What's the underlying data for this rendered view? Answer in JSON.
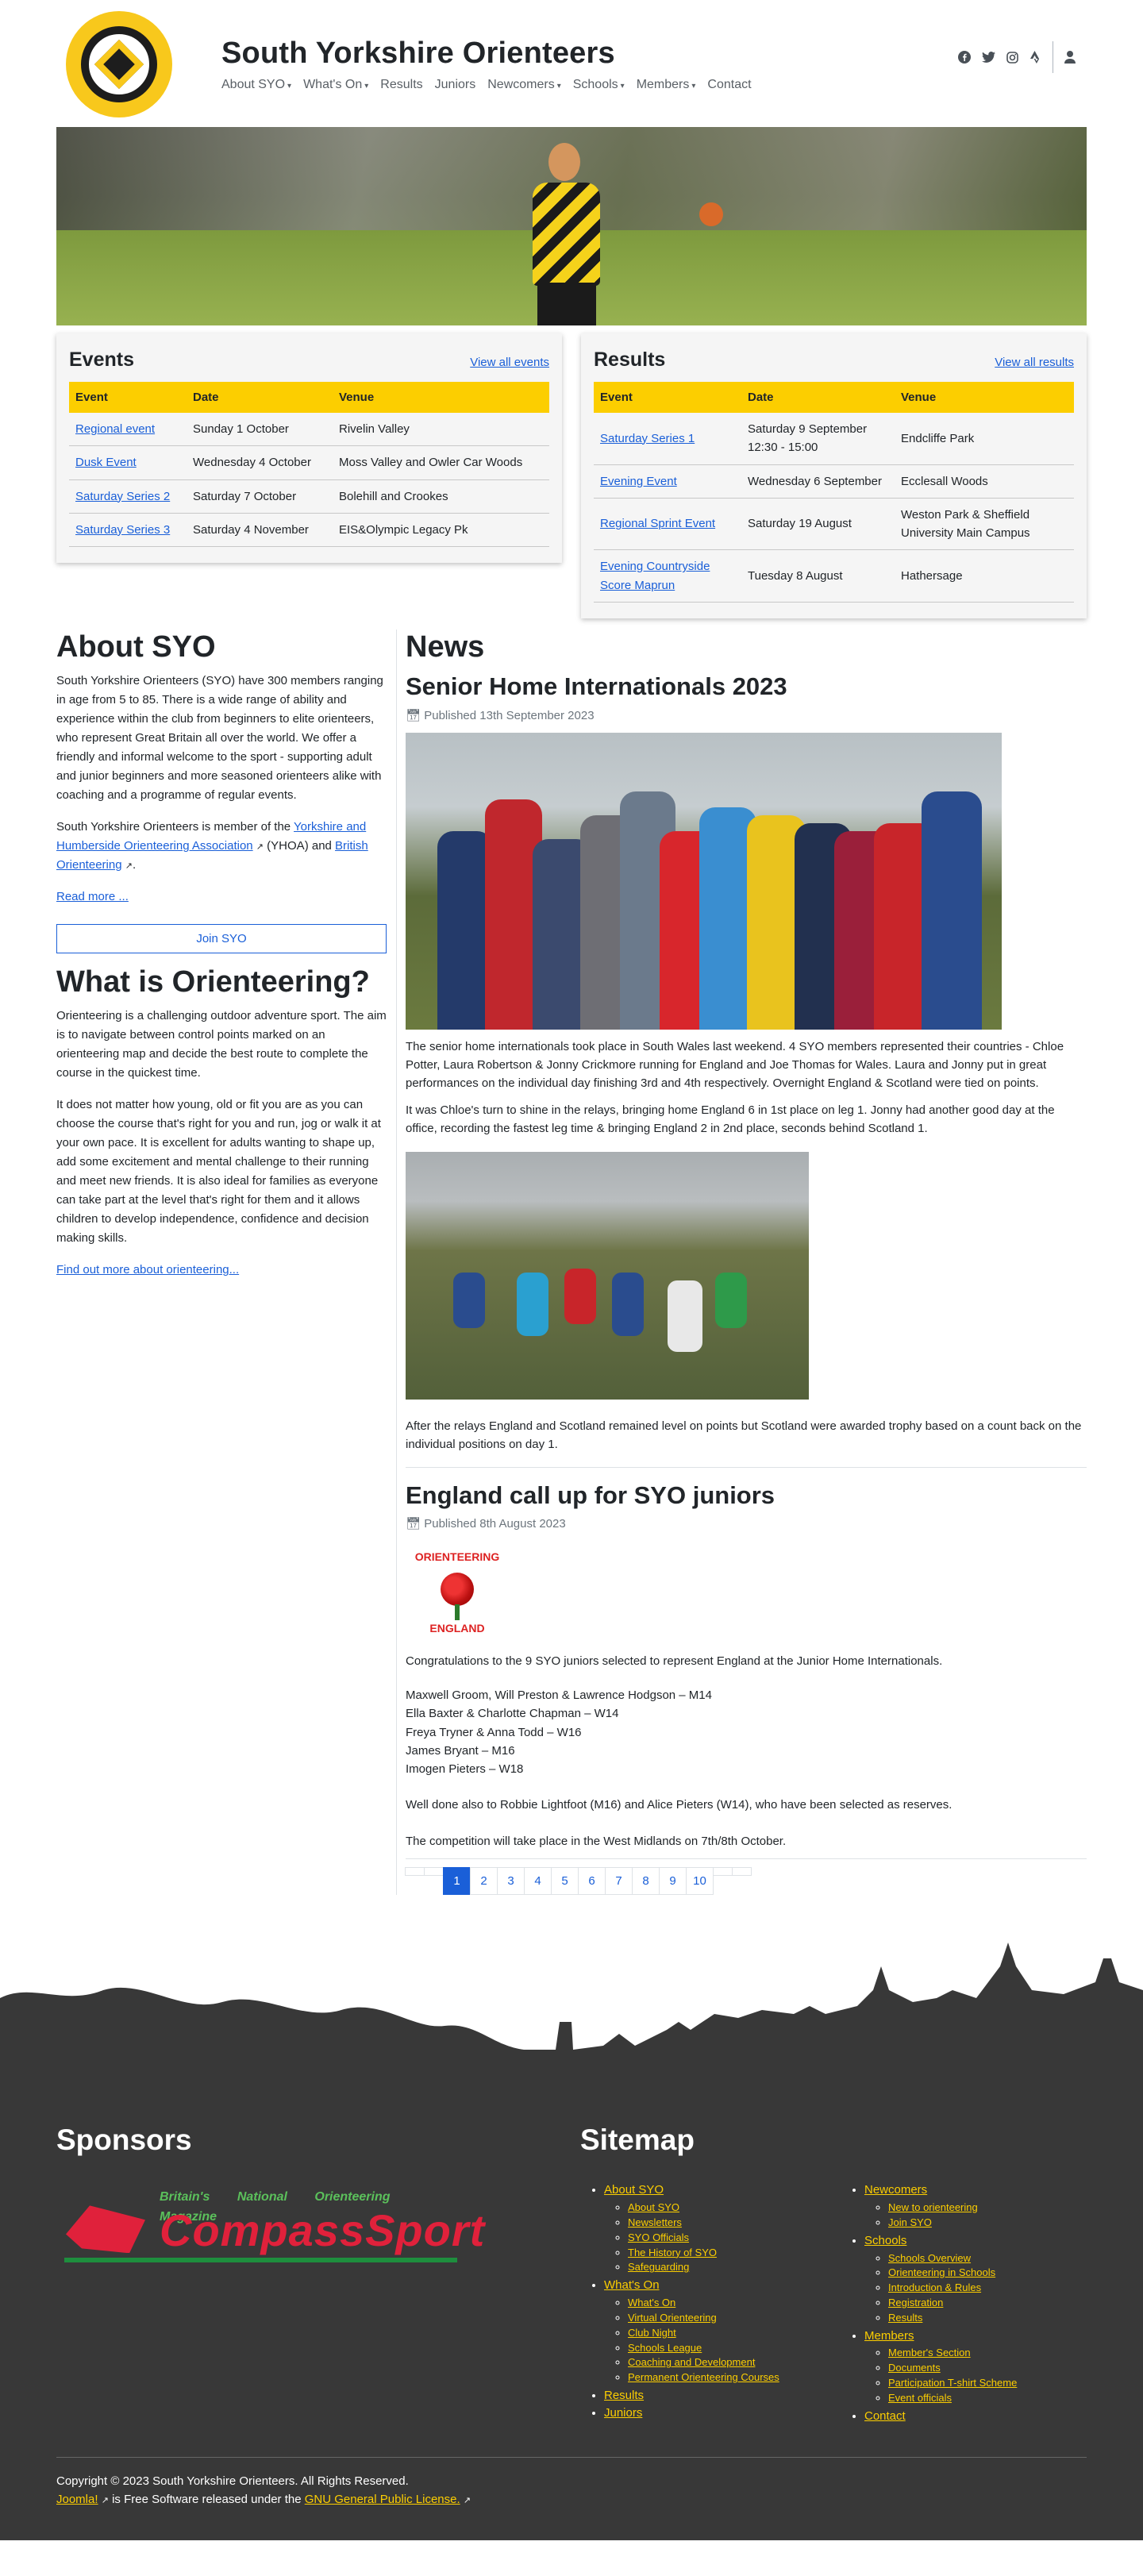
{
  "site": {
    "title": "South Yorkshire Orienteers"
  },
  "nav": [
    {
      "label": "About SYO",
      "dropdown": true
    },
    {
      "label": "What's On",
      "dropdown": true
    },
    {
      "label": "Results",
      "dropdown": false
    },
    {
      "label": "Juniors",
      "dropdown": false
    },
    {
      "label": "Newcomers",
      "dropdown": true
    },
    {
      "label": "Schools",
      "dropdown": true
    },
    {
      "label": "Members",
      "dropdown": true
    },
    {
      "label": "Contact",
      "dropdown": false
    }
  ],
  "social_icons": [
    "facebook-icon",
    "twitter-icon",
    "instagram-icon",
    "strava-icon",
    "user-icon"
  ],
  "events": {
    "title": "Events",
    "link": "View all events",
    "headers": [
      "Event",
      "Date",
      "Venue"
    ],
    "rows": [
      {
        "event": "Regional event",
        "date": "Sunday 1 October",
        "venue": "Rivelin Valley"
      },
      {
        "event": "Dusk Event",
        "date": "Wednesday 4 October",
        "venue": "Moss Valley and Owler Car Woods"
      },
      {
        "event": "Saturday Series 2",
        "date": "Saturday 7 October",
        "venue": "Bolehill and Crookes"
      },
      {
        "event": "Saturday Series 3",
        "date": "Saturday 4 November",
        "venue": "EIS&Olympic Legacy Pk"
      }
    ]
  },
  "results": {
    "title": "Results",
    "link": "View all results",
    "headers": [
      "Event",
      "Date",
      "Venue"
    ],
    "rows": [
      {
        "event": "Saturday Series 1",
        "date": "Saturday 9 September 12:30 - 15:00",
        "venue": "Endcliffe Park"
      },
      {
        "event": "Evening Event",
        "date": "Wednesday 6 September",
        "venue": "Ecclesall Woods"
      },
      {
        "event": "Regional Sprint Event",
        "date": "Saturday 19 August",
        "venue": "Weston Park & Sheffield University Main Campus"
      },
      {
        "event": "Evening Countryside Score Maprun",
        "date": "Tuesday 8 August",
        "venue": "Hathersage"
      }
    ]
  },
  "about": {
    "title": "About SYO",
    "p1": "South Yorkshire Orienteers (SYO) have 300 members ranging in age from 5 to 85. There is a wide range of ability and experience within the club from beginners to elite orienteers, who represent Great Britain all over the world. We offer a friendly and informal welcome to the sport - supporting adult and junior beginners and more seasoned orienteers alike with coaching and a programme of regular events.",
    "p2_prefix": "South Yorkshire Orienteers is member of the ",
    "p2_link1": "Yorkshire and Humberside Orienteering Association",
    "p2_mid": " (YHOA) and ",
    "p2_link2": "British Orienteering",
    "p2_suffix": ".",
    "read_more": "Read more ...",
    "join": "Join SYO"
  },
  "what_is": {
    "title": "What is Orienteering?",
    "p1": "Orienteering is a challenging outdoor adventure sport. The aim is to navigate between control points marked on an orienteering map and decide the best route to complete the course in the quickest time.",
    "p2": "It does not matter how young, old or fit you are as you can choose the course that's right for you and run, jog or walk it at your own pace. It is excellent for adults wanting to shape up, add some excitement and mental challenge to their running and meet new friends. It is also ideal for families as everyone can take part at the level that's right for them and it allows children to develop independence, confidence and decision making skills.",
    "link": "Find out more about orienteering..."
  },
  "news": {
    "title": "News",
    "article1": {
      "title": "Senior Home Internationals 2023",
      "published": "Published 13th September 2023",
      "p1": "The senior home internationals took place in South Wales last weekend. 4 SYO members represented their countries - Chloe Potter, Laura Robertson & Jonny Crickmore running for England and Joe Thomas for Wales. Laura and Jonny put in great performances on the individual day finishing 3rd and 4th respectively. Overnight England & Scotland were tied on points.",
      "p2": "It was Chloe's turn to shine in the relays, bringing home England 6 in 1st place on leg 1. Jonny had another good day at the office, recording the fastest leg time & bringing England 2 in 2nd place, seconds behind Scotland 1.",
      "p3": "After the relays England and Scotland remained level on points but Scotland were awarded trophy based on a count back on the individual positions on day 1."
    },
    "article2": {
      "title": "England call up for SYO juniors",
      "published": "Published 8th August 2023",
      "badge_top": "ORIENTEERING",
      "badge_bottom": "ENGLAND",
      "intro": "Congratulations to the 9 SYO juniors selected to represent England at the Junior Home Internationals.",
      "selections": [
        "Maxwell Groom, Will Preston & Lawrence Hodgson – M14",
        "Ella Baxter & Charlotte Chapman – W14",
        "Freya Tryner & Anna Todd – W16",
        "James Bryant – M16",
        "Imogen Pieters – W18"
      ],
      "reserves": "Well done also to Robbie Lightfoot (M16) and Alice Pieters (W14), who have been selected as reserves.",
      "closing": "The competition will take place in the West Midlands on 7th/8th October."
    },
    "pages": [
      "1",
      "2",
      "3",
      "4",
      "5",
      "6",
      "7",
      "8",
      "9",
      "10"
    ],
    "active_page": "1"
  },
  "footer": {
    "sponsors_title": "Sponsors",
    "sponsor_tag": "Britain's National Orienteering Magazine",
    "sponsor_name": "CompassSport",
    "sitemap_title": "Sitemap",
    "sitemap_col1": [
      {
        "label": "About SYO",
        "children": [
          "About SYO",
          "Newsletters",
          "SYO Officials",
          "The History of SYO",
          "Safeguarding"
        ]
      },
      {
        "label": "What's On",
        "children": [
          "What's On",
          "Virtual Orienteering",
          "Club Night",
          "Schools League",
          "Coaching and Development",
          "Permanent Orienteering Courses"
        ]
      },
      {
        "label": "Results",
        "children": []
      },
      {
        "label": "Juniors",
        "children": []
      }
    ],
    "sitemap_col2": [
      {
        "label": "Newcomers",
        "children": [
          "New to orienteering",
          "Join SYO"
        ]
      },
      {
        "label": "Schools",
        "children": [
          "Schools Overview",
          "Orienteering in Schools",
          "Introduction & Rules",
          "Registration",
          "Results"
        ]
      },
      {
        "label": "Members",
        "children": [
          "Member's Section",
          "Documents",
          "Participation T-shirt Scheme",
          "Event officials"
        ]
      },
      {
        "label": "Contact",
        "children": []
      }
    ],
    "copyright": "Copyright © 2023 South Yorkshire Orienteers. All Rights Reserved.",
    "joomla": "Joomla!",
    "license_mid": " is Free Software released under the ",
    "license_link": "GNU General Public License."
  },
  "colors": {
    "accent": "#fcce00",
    "link": "#1a5fd8",
    "footer_bg": "#383838"
  }
}
